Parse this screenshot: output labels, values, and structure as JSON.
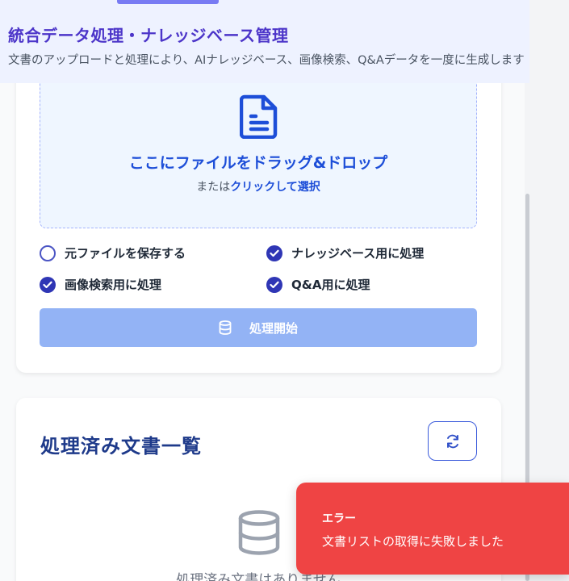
{
  "header": {
    "title": "統合データ処理・ナレッジベース管理",
    "subtitle": "文書のアップロードと処理により、AIナレッジベース、画像検索、Q&Aデータを一度に生成します"
  },
  "upload": {
    "drop_title": "ここにファイルをドラッグ&ドロップ",
    "drop_prefix": "または",
    "drop_link": "クリックして選択",
    "options": [
      {
        "label": "元ファイルを保存する",
        "checked": false
      },
      {
        "label": "ナレッジベース用に処理",
        "checked": true
      },
      {
        "label": "画像検索用に処理",
        "checked": true
      },
      {
        "label": "Q&A用に処理",
        "checked": true
      }
    ],
    "start_label": "処理開始"
  },
  "documents": {
    "title": "処理済み文書一覧",
    "empty_text": "処理済み文書はありません"
  },
  "toast": {
    "title": "エラー",
    "message": "文書リストの取得に失敗しました"
  },
  "colors": {
    "accent": "#1d4ed8",
    "checkbox_on": "#2f36b5",
    "start_button": "#93b3f5",
    "toast_bg": "#ef4444",
    "header_bg": "#eef2ff",
    "title_purple": "#4c35c9"
  },
  "icons": {
    "dropzone": "file-text-icon",
    "start": "database-icon",
    "refresh": "refresh-icon",
    "empty": "database-icon",
    "checked": "check-circle-icon",
    "unchecked": "circle-icon"
  }
}
